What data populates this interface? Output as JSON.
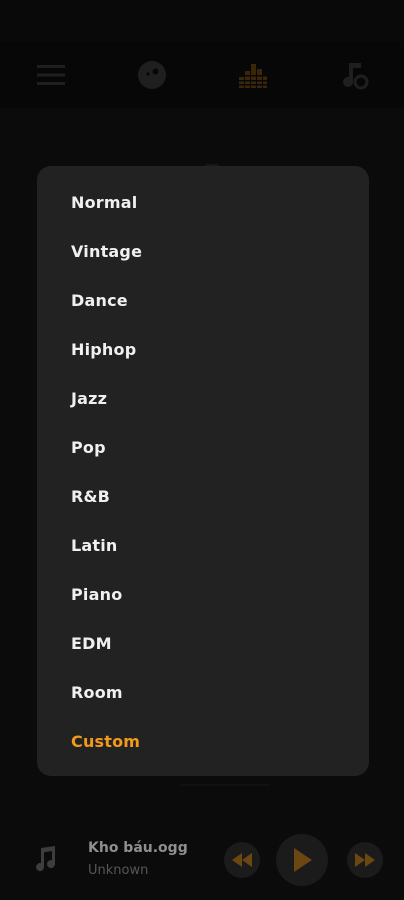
{
  "toolbar": {
    "icons": [
      "menu-icon",
      "disc-icon",
      "equalizer-icon",
      "music-settings-icon"
    ],
    "accent_color": "#f39a1c"
  },
  "preset_menu": {
    "items": [
      "Normal",
      "Vintage",
      "Dance",
      "Hiphop",
      "Jazz",
      "Pop",
      "R&B",
      "Latin",
      "Piano",
      "EDM",
      "Room",
      "Custom"
    ],
    "selected": "Custom"
  },
  "player": {
    "title": "Kho báu.ogg",
    "artist": "Unknown",
    "icons": [
      "music-note-icon",
      "rewind-icon",
      "play-icon",
      "fast-forward-icon"
    ]
  },
  "colors": {
    "background": "#0c0c0c",
    "popup": "#222222",
    "accent": "#f39a1c"
  }
}
